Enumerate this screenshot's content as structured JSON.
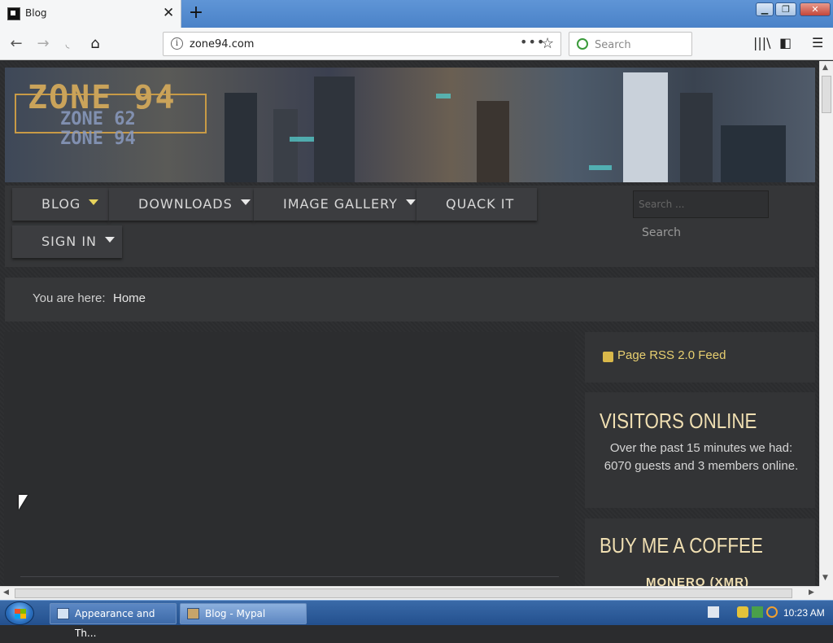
{
  "browser": {
    "tab_title": "Blog",
    "url": "zone94.com",
    "search_placeholder": "Search"
  },
  "site": {
    "logo_main": "ZONE 94",
    "logo_sub_1": "ZONE 62",
    "logo_sub_2": "ZONE 94",
    "menu": [
      {
        "label": "BLOG"
      },
      {
        "label": "DOWNLOADS"
      },
      {
        "label": "IMAGE GALLERY"
      },
      {
        "label": "QUACK IT"
      },
      {
        "label": "SIGN IN"
      }
    ],
    "search_placeholder": "Search ...",
    "search_button": "Search",
    "breadcrumb_label": "You are here:",
    "breadcrumb_home": "Home"
  },
  "sidebar": {
    "rss_label": "Page RSS 2.0 Feed",
    "visitors_title": "VISITORS ONLINE",
    "visitors_text": "Over the past 15 minutes we had: 6070 guests and 3 members online.",
    "coffee_title": "BUY ME A COFFEE",
    "coffee_sub": "MONERO (XMR)"
  },
  "taskbar": {
    "items": [
      {
        "label": "Appearance and Th..."
      },
      {
        "label": "Blog - Mypal"
      }
    ],
    "clock": "10:23 AM"
  }
}
